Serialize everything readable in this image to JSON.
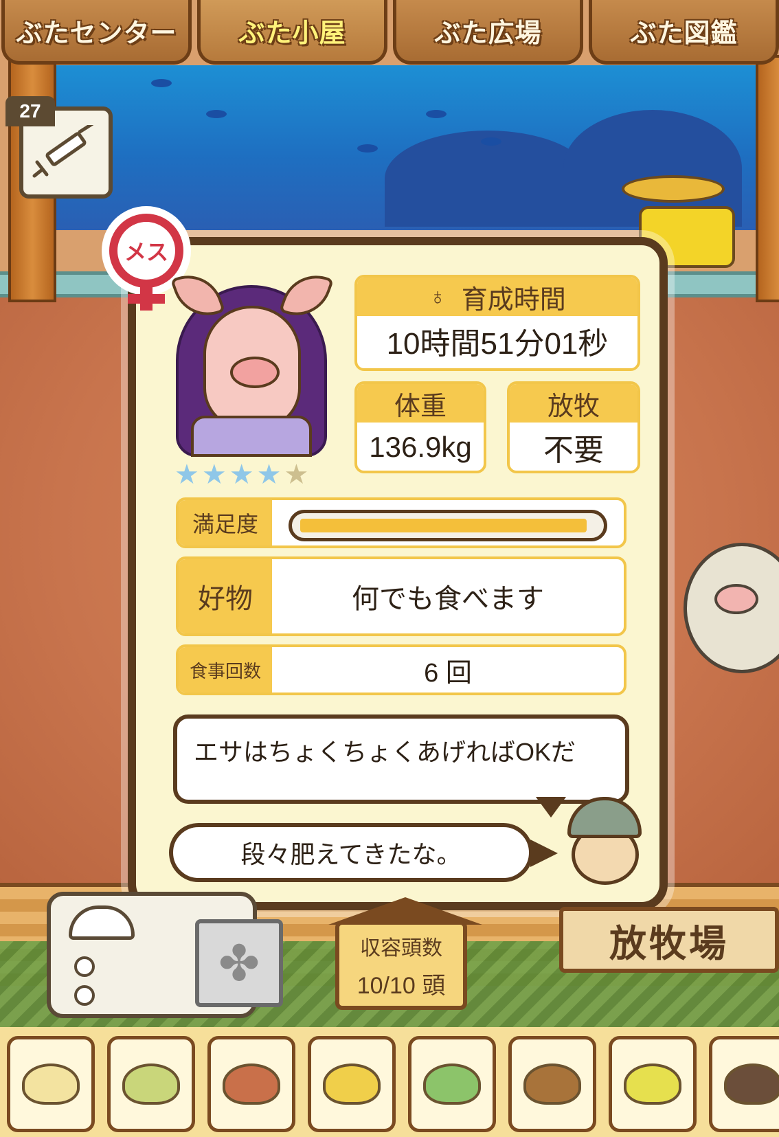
{
  "tabs": [
    {
      "label": "ぶたセンター",
      "active": false
    },
    {
      "label": "ぶた小屋",
      "active": true
    },
    {
      "label": "ぶた広場",
      "active": false
    },
    {
      "label": "ぶた図鑑",
      "active": false
    }
  ],
  "syringe": {
    "count": "27",
    "icon": "syringe-icon"
  },
  "pig": {
    "gender": "メス",
    "rating": 4,
    "max_rating": 5,
    "raise_time_label": "育成時間",
    "raise_time_value": "10時間51分01秒",
    "weight_label": "体重",
    "weight_value": "136.9kg",
    "graze_label": "放牧",
    "graze_value": "不要",
    "satisfaction_label": "満足度",
    "satisfaction_level": 0.97,
    "favorite_label": "好物",
    "favorite_value": "何でも食べます",
    "meals_label": "食事回数",
    "meals_value": "6 回"
  },
  "dialogue": {
    "hint": "エサはちょくちょくあげればOKだ",
    "comment": "段々肥えてきたな。"
  },
  "capacity": {
    "label": "収容頭数",
    "value": "10/10 頭"
  },
  "pasture_sign": "放牧場",
  "feeds": [
    {
      "name": "beans-icon"
    },
    {
      "name": "mixed-beans-icon"
    },
    {
      "name": "sweet-potato-icon"
    },
    {
      "name": "corn-icon"
    },
    {
      "name": "vegetables-icon"
    },
    {
      "name": "acorn-icon"
    },
    {
      "name": "rice-bowl-icon"
    },
    {
      "name": "meatball-icon"
    }
  ],
  "colors": {
    "accent": "#f6c94e",
    "frame": "#5a3b1e",
    "gender": "#d23646"
  }
}
